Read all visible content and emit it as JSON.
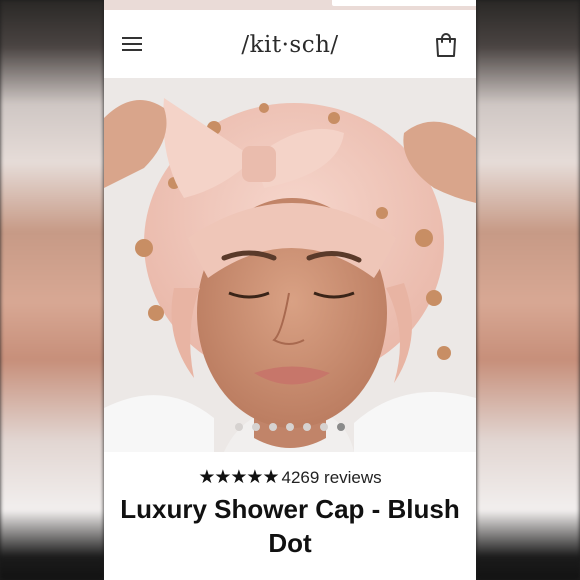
{
  "header": {
    "logo_text": "/kit·sch/",
    "menu_icon": "hamburger-menu-icon",
    "cart_icon": "shopping-bag-icon"
  },
  "gallery": {
    "slide_count": 7,
    "active_index": 6
  },
  "product": {
    "rating_stars": "★★★★★",
    "review_count": "4269 reviews",
    "title": "Luxury Shower Cap - Blush Dot"
  },
  "colors": {
    "cap_blush": "#f1c9bd",
    "polka_dot": "#c88e64",
    "active_dot": "#8a8a8a"
  }
}
